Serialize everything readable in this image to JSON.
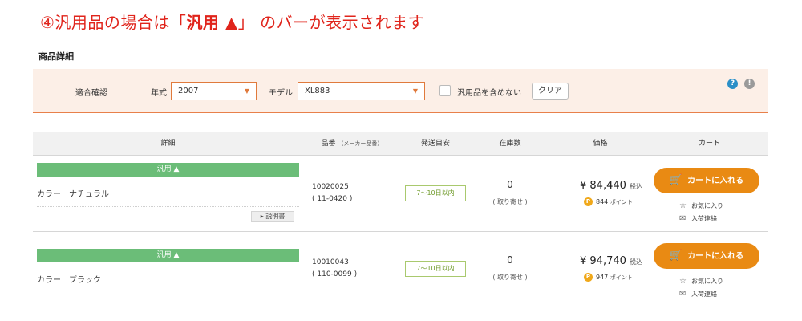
{
  "headline": {
    "prefix": "④汎用品の場合は「",
    "bold": "汎用 ▲",
    "suffix": "」 のバーが表示されます"
  },
  "section_title": "商品詳細",
  "filter": {
    "fitment_label": "適合確認",
    "year_label": "年式",
    "year_value": "2007",
    "model_label": "モデル",
    "model_value": "XL883",
    "include_generic_label": "汎用品を含めない",
    "clear_label": "クリア",
    "help_symbol": "?",
    "info_symbol": "!"
  },
  "table": {
    "headers": {
      "detail": "詳細",
      "part_no": "品番",
      "part_no_note": "（メーカー品番）",
      "shipping": "発送目安",
      "stock": "在庫数",
      "price": "価格",
      "cart": "カート"
    },
    "rows": [
      {
        "generic_bar": "汎用 ▲",
        "color": "カラー　ナチュラル",
        "manual": "▸ 説明書",
        "part_no": "10020025",
        "maker_no": "( 11-0420 )",
        "shipping": "7〜10日以内",
        "stock": "0",
        "stock_note": "( 取り寄せ )",
        "price": "¥ 84,440",
        "tax_note": "税込",
        "points": "844",
        "points_unit": "ポイント",
        "cart_label": "カートに入れる",
        "favorite": "お気に入り",
        "restock": "入荷連絡"
      },
      {
        "generic_bar": "汎用 ▲",
        "color": "カラー　ブラック",
        "part_no": "10010043",
        "maker_no": "( 110-0099 )",
        "shipping": "7〜10日以内",
        "stock": "0",
        "stock_note": "( 取り寄せ )",
        "price": "¥ 94,740",
        "tax_note": "税込",
        "points": "947",
        "points_unit": "ポイント",
        "cart_label": "カートに入れる",
        "favorite": "お気に入り",
        "restock": "入荷連絡"
      }
    ]
  },
  "colors": {
    "headline": "#e0241b",
    "generic_bar": "#6bbd78",
    "cart_button": "#e98a13",
    "filter_bg": "#fcefe7",
    "shipping_badge": "#a9c96e"
  },
  "icons": {
    "select_arrow": "▼",
    "point": "P",
    "cart": "🛒",
    "favorite": "☆",
    "restock": "✉"
  }
}
